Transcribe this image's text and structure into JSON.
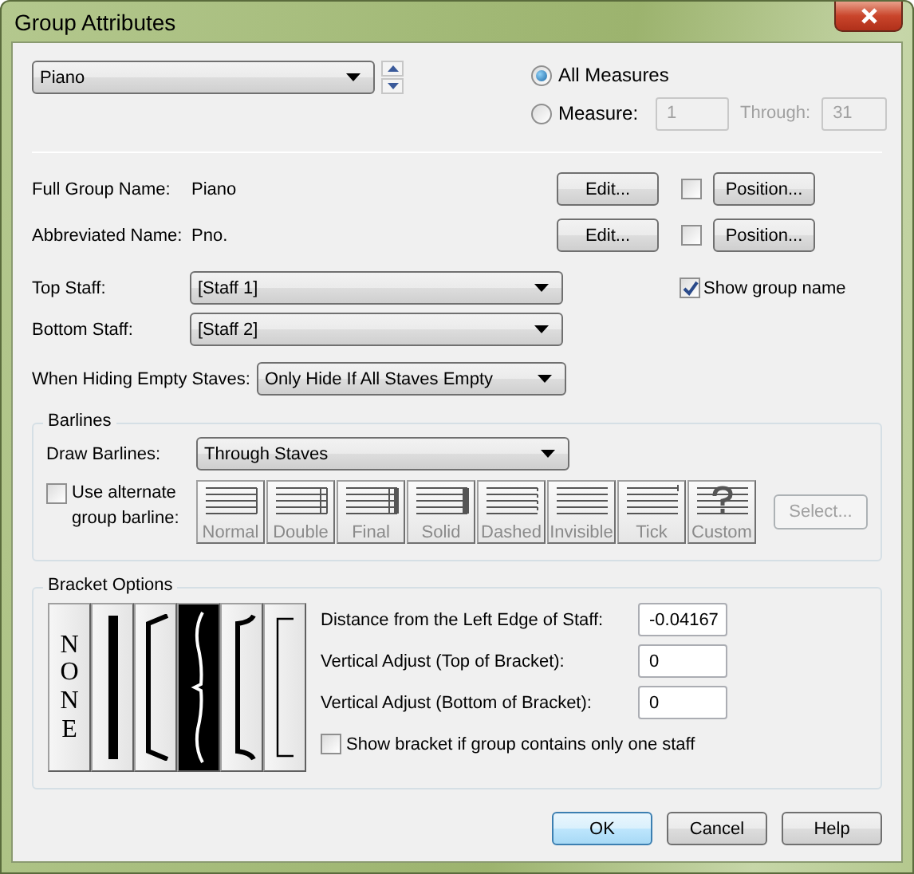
{
  "window": {
    "title": "Group Attributes"
  },
  "group_select": {
    "value": "Piano"
  },
  "range": [
    {
      "label": "All Measures",
      "selected": true
    },
    {
      "label": "Measure:",
      "selected": false
    }
  ],
  "measure": {
    "from": "1",
    "through_label": "Through:",
    "to": "31",
    "disabled": true
  },
  "names": [
    {
      "label": "Full Group Name:",
      "value": "Piano",
      "edit": "Edit...",
      "checked": false,
      "position": "Position..."
    },
    {
      "label": "Abbreviated Name:",
      "value": "Pno.",
      "edit": "Edit...",
      "checked": false,
      "position": "Position..."
    }
  ],
  "staff_selects": [
    {
      "label": "Top Staff:",
      "value": "[Staff 1]"
    },
    {
      "label": "Bottom Staff:",
      "value": "[Staff 2]"
    }
  ],
  "show_group_name": {
    "label": "Show group name",
    "checked": true
  },
  "hiding": {
    "label": "When Hiding Empty Staves:",
    "value": "Only Hide If All Staves Empty"
  },
  "barlines": {
    "title": "Barlines",
    "draw_label": "Draw Barlines:",
    "draw_value": "Through Staves",
    "alternate": {
      "label": "Use alternate group barline:",
      "checked": false
    },
    "styles": [
      {
        "kind": "normal",
        "label": "Normal",
        "disabled": true
      },
      {
        "kind": "double",
        "label": "Double",
        "disabled": true
      },
      {
        "kind": "final",
        "label": "Final",
        "disabled": true
      },
      {
        "kind": "solid",
        "label": "Solid",
        "disabled": true
      },
      {
        "kind": "dashed",
        "label": "Dashed",
        "disabled": true
      },
      {
        "kind": "invisible",
        "label": "Invisible",
        "disabled": true
      },
      {
        "kind": "tick",
        "label": "Tick",
        "disabled": true
      },
      {
        "kind": "custom",
        "label": "Custom",
        "disabled": true
      }
    ],
    "select_button": {
      "label": "Select...",
      "disabled": true
    }
  },
  "bracket_options": {
    "title": "Bracket Options",
    "brackets": [
      {
        "kind": "none",
        "label": "NONE",
        "selected": false
      },
      {
        "kind": "bar",
        "selected": false
      },
      {
        "kind": "bracket",
        "selected": false
      },
      {
        "kind": "brace",
        "selected": true
      },
      {
        "kind": "piano",
        "selected": false
      },
      {
        "kind": "square",
        "selected": false
      }
    ],
    "fields": [
      {
        "label": "Distance from the Left Edge of Staff:",
        "value": "-0.04167"
      },
      {
        "label": "Vertical Adjust (Top of Bracket):",
        "value": "0"
      },
      {
        "label": "Vertical Adjust (Bottom of Bracket):",
        "value": "0"
      }
    ],
    "single_staff": {
      "label": "Show bracket if group contains only one staff",
      "checked": false
    }
  },
  "buttons": [
    {
      "label": "OK",
      "default": true
    },
    {
      "label": "Cancel",
      "default": false
    },
    {
      "label": "Help",
      "default": false
    }
  ]
}
